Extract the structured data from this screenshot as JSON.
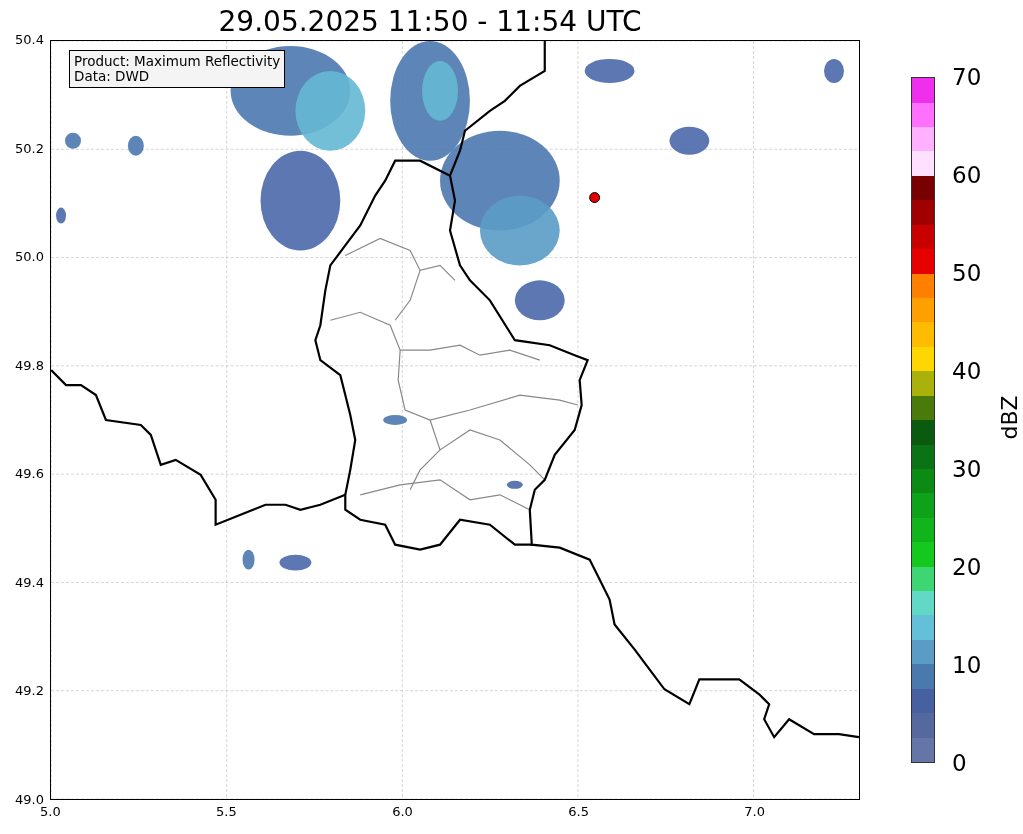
{
  "title": "29.05.2025 11:50 - 11:54 UTC",
  "legend": [
    "Product: Maximum Reflectivity",
    "Data: DWD"
  ],
  "y_ticks": [
    "50.4",
    "50.2",
    "50.0",
    "49.8",
    "49.6",
    "49.4",
    "49.2",
    "49.0"
  ],
  "x_ticks": [
    "5.0",
    "5.5",
    "6.0",
    "6.5",
    "7.0"
  ],
  "colorbar": {
    "label": "dBZ",
    "ticks": [
      "70",
      "60",
      "50",
      "40",
      "30",
      "20",
      "10",
      "0"
    ],
    "segments": [
      {
        "color": "#6475a6"
      },
      {
        "color": "#56699f"
      },
      {
        "color": "#4660a0"
      },
      {
        "color": "#4a7aad"
      },
      {
        "color": "#5a9cc6"
      },
      {
        "color": "#64c0d8"
      },
      {
        "color": "#62d8c6"
      },
      {
        "color": "#3ed672"
      },
      {
        "color": "#14c81e"
      },
      {
        "color": "#12b41c"
      },
      {
        "color": "#0ea21a"
      },
      {
        "color": "#0b8a14"
      },
      {
        "color": "#0b7216"
      },
      {
        "color": "#0a5a10"
      },
      {
        "color": "#4a7a0c"
      },
      {
        "color": "#aab10a"
      },
      {
        "color": "#ffd700"
      },
      {
        "color": "#ffbb00"
      },
      {
        "color": "#ff9f00"
      },
      {
        "color": "#ff7f00"
      },
      {
        "color": "#e60000"
      },
      {
        "color": "#c80000"
      },
      {
        "color": "#a00000"
      },
      {
        "color": "#780000"
      },
      {
        "color": "#ffe0ff"
      },
      {
        "color": "#ffb0ff"
      },
      {
        "color": "#ff70ff"
      },
      {
        "color": "#ee30ee"
      }
    ]
  }
}
